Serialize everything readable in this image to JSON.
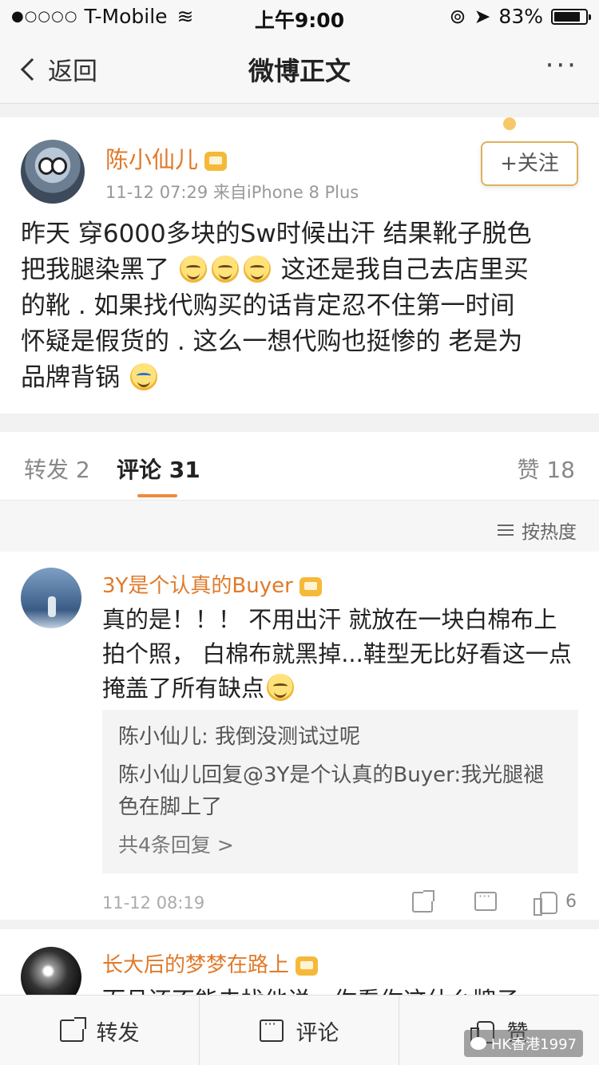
{
  "status_bar": {
    "signal": "●○○○○",
    "carrier": "T-Mobile",
    "wifi": "≋",
    "time": "上午9:00",
    "lock": "⊚",
    "location": "➤",
    "battery_percent": "83%",
    "battery_level": 0.83
  },
  "nav": {
    "back_label": "返回",
    "title": "微博正文",
    "more": "···"
  },
  "post": {
    "username": "陈小仙儿",
    "time": "11-12 07:29",
    "source": "来自iPhone 8 Plus",
    "follow_label": "+关注",
    "line1": "昨天 穿6000多块的Sw时候出汗 结果靴子脱色",
    "line2a": "把我腿染黑了",
    "line2b": "这还是我自己去店里买",
    "line3": "的靴 . 如果找代购买的话肯定忍不住第一时间",
    "line4": "怀疑是假货的 . 这么一想代购也挺惨的 老是为",
    "line5": "品牌背锅"
  },
  "tabs": {
    "repost": "转发 2",
    "comment": "评论 31",
    "like": "赞 18"
  },
  "sort": {
    "label": "按热度"
  },
  "comments": [
    {
      "username": "3Y是个认真的Buyer",
      "text_a": "真的是！！！ 不用出汗 就放在一块白棉布上拍个照， 白棉布就黑掉...鞋型无比好看这一点掩盖了所有缺点",
      "replies": [
        "陈小仙儿: 我倒没测试过呢",
        "陈小仙儿回复@3Y是个认真的Buyer:我光腿褪色在脚上了"
      ],
      "more_replies": "共4条回复 >",
      "time": "11-12 08:19",
      "likes": "6"
    },
    {
      "username": "长大后的梦梦在路上",
      "text": "而且还不能去找他说，你看你这什么牌子"
    }
  ],
  "toolbar": {
    "repost": "转发",
    "comment": "评论",
    "like": "赞"
  },
  "watermark": "HK香港1997"
}
